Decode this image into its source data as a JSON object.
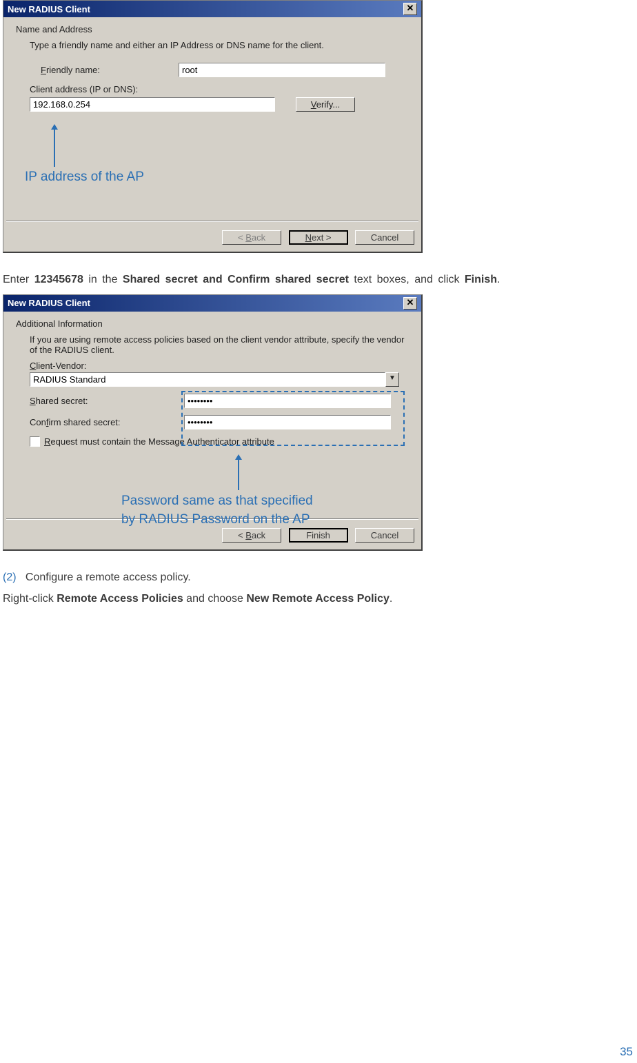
{
  "dialog1": {
    "title": "New RADIUS Client",
    "section": "Name and Address",
    "description": "Type a friendly name and either an IP Address or DNS name for the client.",
    "friendly_label_pre": "F",
    "friendly_label_post": "riendly name:",
    "friendly_value": "root",
    "client_addr_label": "Client address (IP or DNS):",
    "client_addr_value": "192.168.0.254",
    "verify_label_pre": "V",
    "verify_label_post": "erify...",
    "back_label": "< Back",
    "back_u": "B",
    "next_label_pre": "N",
    "next_label_post": "ext >",
    "cancel_label": "Cancel"
  },
  "annot1": "IP address of the AP",
  "paragraph1_pre": "Enter ",
  "paragraph1_bold1": "12345678",
  "paragraph1_mid": " in the ",
  "paragraph1_bold2": "Shared secret and Confirm shared secret",
  "paragraph1_post": " text boxes, and click ",
  "paragraph1_bold3": "Finish",
  "paragraph1_end": ".",
  "dialog2": {
    "title": "New RADIUS Client",
    "section": "Additional Information",
    "description": "If you are using remote access policies based on the client vendor attribute, specify the vendor of the RADIUS client.",
    "vendor_label_pre": "C",
    "vendor_label_post": "lient-Vendor:",
    "vendor_value": "RADIUS Standard",
    "shared_label_pre": "S",
    "shared_label_post": "hared secret:",
    "shared_value": "••••••••",
    "confirm_label_pre": "C",
    "confirm_label_mid": "on",
    "confirm_label_u": "f",
    "confirm_label_post": "irm shared secret:",
    "confirm_value": "••••••••",
    "request_label_pre": "R",
    "request_label_post": "equest must contain the Message Authenticator attribute",
    "back_label": "< Back",
    "back_u": "B",
    "finish_label": "Finish",
    "cancel_label": "Cancel"
  },
  "annot2_line1": "Password same as that specified",
  "annot2_line2": "by RADIUS Password on the AP",
  "step_num": "(2)",
  "step_text": "Configure a remote access policy.",
  "paragraph2_pre": "Right-click ",
  "paragraph2_bold1": "Remote Access Policies",
  "paragraph2_mid": " and choose ",
  "paragraph2_bold2": "New Remote Access Policy",
  "paragraph2_end": ".",
  "page_number": "35",
  "icons": {
    "close": "✕",
    "dropdown": "▼"
  }
}
